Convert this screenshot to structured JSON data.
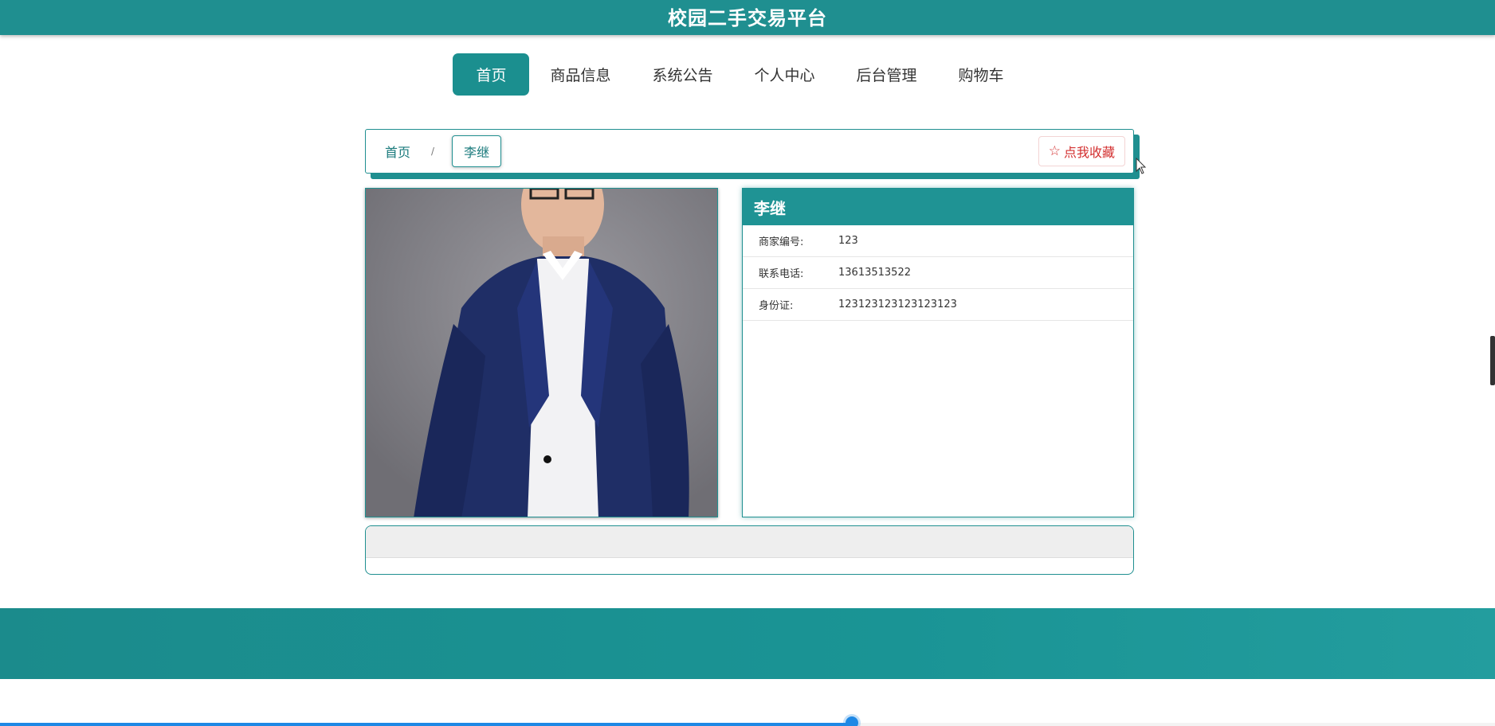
{
  "header": {
    "site_title": "校园二手交易平台"
  },
  "nav": {
    "items": [
      {
        "label": "首页",
        "active": true
      },
      {
        "label": "商品信息",
        "active": false
      },
      {
        "label": "系统公告",
        "active": false
      },
      {
        "label": "个人中心",
        "active": false
      },
      {
        "label": "后台管理",
        "active": false
      },
      {
        "label": "购物车",
        "active": false
      }
    ]
  },
  "breadcrumb": {
    "home": "首页",
    "separator": "/",
    "current": "李继",
    "collect_label": "点我收藏",
    "collect_icon": "☆"
  },
  "merchant": {
    "name": "李继",
    "fields": [
      {
        "label": "商家编号:",
        "value": "123"
      },
      {
        "label": "联系电话:",
        "value": "13613513522"
      },
      {
        "label": "身份证:",
        "value": "123123123123123123"
      }
    ]
  },
  "video_progress": {
    "fraction": 0.57
  },
  "colors": {
    "primary": "#1f8f90",
    "accent_red": "#d32f2f",
    "progress_blue": "#1e88e5"
  }
}
